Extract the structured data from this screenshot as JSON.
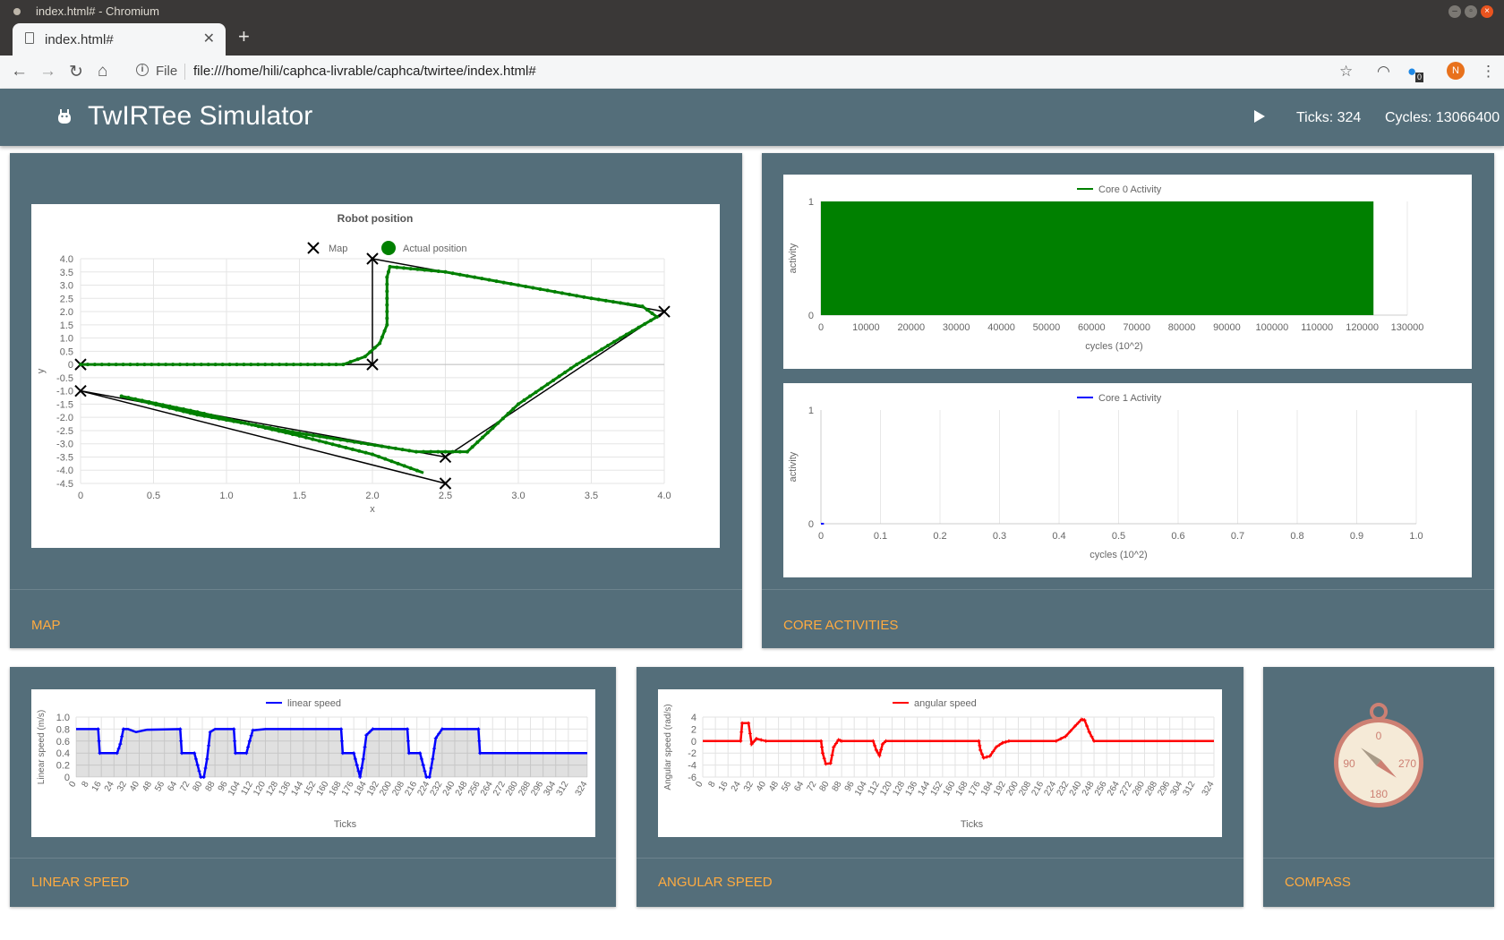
{
  "browser": {
    "window_title": "index.html# - Chromium",
    "tab_title": "index.html#",
    "new_tab": "+",
    "scheme_label": "File",
    "url": "file:///home/hili/caphca-livrable/caphca/twirtee/index.html#",
    "avatar_letter": "N",
    "ext_badge": "0"
  },
  "app": {
    "title": "TwIRTee Simulator",
    "ticks": "Ticks: 324",
    "cycles": "Cycles: 13066400"
  },
  "cards": {
    "map": "MAP",
    "core": "CORE ACTIVITIES",
    "linear": "LINEAR SPEED",
    "angular": "ANGULAR SPEED",
    "compass": "COMPASS"
  },
  "compass": {
    "n": "0",
    "w": "90",
    "e": "270",
    "s": "180",
    "heading_deg": 130
  },
  "colors": {
    "header": "#546e7a",
    "accent": "#ffab40",
    "map_path": "#008000",
    "linear": "#0000ff",
    "angular": "#ff0000"
  },
  "chart_data": [
    {
      "id": "robot-position",
      "type": "scatter",
      "title": "Robot position",
      "xlabel": "x",
      "ylabel": "y",
      "xlim": [
        0,
        4.0
      ],
      "ylim": [
        -4.5,
        4.0
      ],
      "xticks": [
        "0",
        "0.5",
        "1.0",
        "1.5",
        "2.0",
        "2.5",
        "3.0",
        "3.5",
        "4.0"
      ],
      "yticks": [
        "4.0",
        "3.5",
        "3.0",
        "2.5",
        "2.0",
        "1.5",
        "1.0",
        "0.5",
        "0",
        "-0.5",
        "-1.0",
        "-1.5",
        "-2.0",
        "-2.5",
        "-3.0",
        "-3.5",
        "-4.0",
        "-4.5"
      ],
      "legend": [
        "Map",
        "Actual position"
      ],
      "map_points": [
        [
          0,
          0
        ],
        [
          2,
          0
        ],
        [
          2,
          4
        ],
        [
          4,
          2
        ],
        [
          2.5,
          -3.5
        ],
        [
          0,
          -1
        ],
        [
          2.5,
          -4.5
        ]
      ],
      "actual_position": [
        [
          0,
          0
        ],
        [
          1.8,
          0
        ],
        [
          1.95,
          0.3
        ],
        [
          2.05,
          0.8
        ],
        [
          2.1,
          1.5
        ],
        [
          2.1,
          2.5
        ],
        [
          2.1,
          3.3
        ],
        [
          2.12,
          3.7
        ],
        [
          2.5,
          3.5
        ],
        [
          3.0,
          3.0
        ],
        [
          3.5,
          2.5
        ],
        [
          3.85,
          2.2
        ],
        [
          3.95,
          1.8
        ],
        [
          3.7,
          1.0
        ],
        [
          3.4,
          0.0
        ],
        [
          3.0,
          -1.5
        ],
        [
          2.65,
          -3.3
        ],
        [
          2.3,
          -3.3
        ],
        [
          1.5,
          -2.6
        ],
        [
          0.8,
          -1.9
        ],
        [
          0.28,
          -1.2
        ],
        [
          0.8,
          -1.8
        ],
        [
          1.5,
          -2.7
        ],
        [
          2.0,
          -3.4
        ],
        [
          2.35,
          -4.1
        ]
      ]
    },
    {
      "id": "core0",
      "type": "area",
      "legend": "Core 0 Activity",
      "xlabel": "cycles (10^2)",
      "ylabel": "activity",
      "xlim": [
        0,
        130000
      ],
      "ylim": [
        0,
        1
      ],
      "xticks": [
        "0",
        "10000",
        "20000",
        "30000",
        "40000",
        "50000",
        "60000",
        "70000",
        "80000",
        "90000",
        "100000",
        "110000",
        "120000",
        "130000"
      ],
      "yticks": [
        "1",
        "0"
      ],
      "active_from": 0,
      "active_to": 122500,
      "value": 1
    },
    {
      "id": "core1",
      "type": "line",
      "legend": "Core 1 Activity",
      "xlabel": "cycles (10^2)",
      "ylabel": "activity",
      "xlim": [
        0,
        1.0
      ],
      "ylim": [
        0,
        1
      ],
      "xticks": [
        "0",
        "0.1",
        "0.2",
        "0.3",
        "0.4",
        "0.5",
        "0.6",
        "0.7",
        "0.8",
        "0.9",
        "1.0"
      ],
      "yticks": [
        "1",
        "0"
      ],
      "values": [
        [
          0,
          0
        ],
        [
          0.005,
          0
        ]
      ]
    },
    {
      "id": "linear",
      "type": "area",
      "legend": "linear speed",
      "xlabel": "Ticks",
      "ylabel": "Linear speed (m/s)",
      "ylim": [
        0,
        1.0
      ],
      "yticks": [
        "1.0",
        "0.8",
        "0.6",
        "0.4",
        "0.2",
        "0"
      ],
      "xticks": [
        "0",
        "8",
        "16",
        "24",
        "32",
        "40",
        "48",
        "56",
        "64",
        "72",
        "80",
        "88",
        "96",
        "104",
        "112",
        "120",
        "128",
        "136",
        "144",
        "152",
        "160",
        "168",
        "176",
        "184",
        "192",
        "200",
        "208",
        "216",
        "224",
        "232",
        "240",
        "248",
        "256",
        "264",
        "272",
        "280",
        "288",
        "296",
        "304",
        "312",
        "324"
      ],
      "xmax": 324,
      "points": [
        [
          0,
          0.8
        ],
        [
          14,
          0.8
        ],
        [
          15,
          0.4
        ],
        [
          24,
          0.4
        ],
        [
          26,
          0.4
        ],
        [
          28,
          0.55
        ],
        [
          30,
          0.8
        ],
        [
          33,
          0.8
        ],
        [
          38,
          0.75
        ],
        [
          45,
          0.79
        ],
        [
          66,
          0.8
        ],
        [
          67,
          0.4
        ],
        [
          75,
          0.4
        ],
        [
          77,
          0.2
        ],
        [
          79,
          0
        ],
        [
          81,
          0
        ],
        [
          83,
          0.3
        ],
        [
          85,
          0.75
        ],
        [
          88,
          0.8
        ],
        [
          100,
          0.8
        ],
        [
          101,
          0.4
        ],
        [
          108,
          0.4
        ],
        [
          110,
          0.6
        ],
        [
          112,
          0.78
        ],
        [
          120,
          0.8
        ],
        [
          168,
          0.8
        ],
        [
          169,
          0.4
        ],
        [
          176,
          0.4
        ],
        [
          178,
          0.2
        ],
        [
          180,
          0
        ],
        [
          182,
          0.3
        ],
        [
          184,
          0.7
        ],
        [
          188,
          0.8
        ],
        [
          210,
          0.8
        ],
        [
          211,
          0.4
        ],
        [
          218,
          0.4
        ],
        [
          220,
          0.2
        ],
        [
          222,
          0
        ],
        [
          224,
          0
        ],
        [
          226,
          0.3
        ],
        [
          228,
          0.65
        ],
        [
          232,
          0.8
        ],
        [
          255,
          0.8
        ],
        [
          256,
          0.4
        ],
        [
          324,
          0.4
        ]
      ]
    },
    {
      "id": "angular",
      "type": "line",
      "legend": "angular speed",
      "xlabel": "Ticks",
      "ylabel": "Angular speed (rad/s)",
      "ylim": [
        -6,
        4
      ],
      "yticks": [
        "4",
        "2",
        "0",
        "-2",
        "-4",
        "-6"
      ],
      "xticks": [
        "0",
        "8",
        "16",
        "24",
        "32",
        "40",
        "48",
        "56",
        "64",
        "72",
        "80",
        "88",
        "96",
        "104",
        "112",
        "120",
        "128",
        "136",
        "144",
        "152",
        "160",
        "168",
        "176",
        "184",
        "192",
        "200",
        "208",
        "216",
        "224",
        "232",
        "240",
        "248",
        "256",
        "264",
        "272",
        "280",
        "288",
        "296",
        "304",
        "312",
        "324"
      ],
      "xmax": 324,
      "points": [
        [
          0,
          0
        ],
        [
          24,
          0
        ],
        [
          25,
          3
        ],
        [
          29,
          3
        ],
        [
          31,
          -0.5
        ],
        [
          34,
          0.4
        ],
        [
          40,
          0
        ],
        [
          75,
          0
        ],
        [
          76,
          -2
        ],
        [
          78,
          -3.8
        ],
        [
          81,
          -3.7
        ],
        [
          83,
          -1
        ],
        [
          86,
          0.2
        ],
        [
          88,
          0
        ],
        [
          108,
          0
        ],
        [
          110,
          -1.5
        ],
        [
          112,
          -2.4
        ],
        [
          114,
          -0.5
        ],
        [
          116,
          0
        ],
        [
          175,
          0
        ],
        [
          176,
          -1.5
        ],
        [
          178,
          -2.8
        ],
        [
          182,
          -2.5
        ],
        [
          186,
          -1
        ],
        [
          190,
          -0.3
        ],
        [
          194,
          0
        ],
        [
          224,
          0
        ],
        [
          230,
          0.8
        ],
        [
          236,
          2.5
        ],
        [
          240,
          3.6
        ],
        [
          242,
          3.5
        ],
        [
          245,
          1.5
        ],
        [
          248,
          0
        ],
        [
          324,
          0
        ]
      ]
    }
  ]
}
